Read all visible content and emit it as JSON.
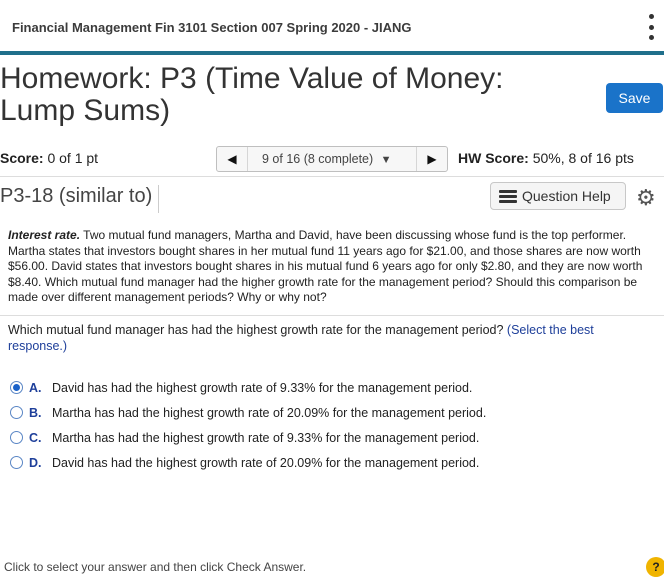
{
  "header": {
    "course_title": "Financial Management Fin 3101 Section 007 Spring 2020 - JIANG",
    "menu_icon": "kebab-menu-icon"
  },
  "homework": {
    "title_line1": "Homework: P3 (Time Value of Money:",
    "title_line2": "Lump Sums)",
    "save_label": "Save"
  },
  "score": {
    "label": "Score:",
    "value": "0 of 1 pt"
  },
  "navigation": {
    "prev_icon": "triangle-left-icon",
    "next_icon": "triangle-right-icon",
    "current": "9 of 16 (8 complete)",
    "dropdown_icon": "chevron-down-icon"
  },
  "hw_score": {
    "label": "HW Score:",
    "value": "50%, 8 of 16 pts"
  },
  "question_header": {
    "id": "P3-18 (similar to)",
    "help_label": "Question Help",
    "settings_icon": "gear-icon"
  },
  "problem": {
    "lead": "Interest rate.",
    "text": "Two mutual fund managers, Martha and David, have been discussing whose fund is the top performer.  Martha states that investors bought shares in her mutual fund 11 years ago for $21.00, and those shares are now worth $56.00.  David states that investors bought shares in his mutual fund 6 years ago for only $2.80, and they are now worth $8.40.  Which mutual fund manager had the higher growth rate for the management period?  Should this comparison be made over different management periods?  Why or why not?"
  },
  "question": {
    "text": "Which mutual fund manager has had the highest growth rate for the management period?",
    "hint": "(Select the best response.)"
  },
  "options": [
    {
      "letter": "A.",
      "text": "David has had the highest growth rate of 9.33% for the management period.",
      "selected": true
    },
    {
      "letter": "B.",
      "text": "Martha has had the highest growth rate of 20.09% for the management period.",
      "selected": false
    },
    {
      "letter": "C.",
      "text": "Martha has had the highest growth rate of 9.33% for the management period.",
      "selected": false
    },
    {
      "letter": "D.",
      "text": "David has had the highest growth rate of 20.09% for the management period.",
      "selected": false
    }
  ],
  "footer": {
    "instruction": "Click to select your answer and then click Check Answer.",
    "help_bubble": "?"
  },
  "colors": {
    "header_rule": "#1f6f8b",
    "save_button": "#1a73c9",
    "link_blue": "#1e3f9a"
  }
}
